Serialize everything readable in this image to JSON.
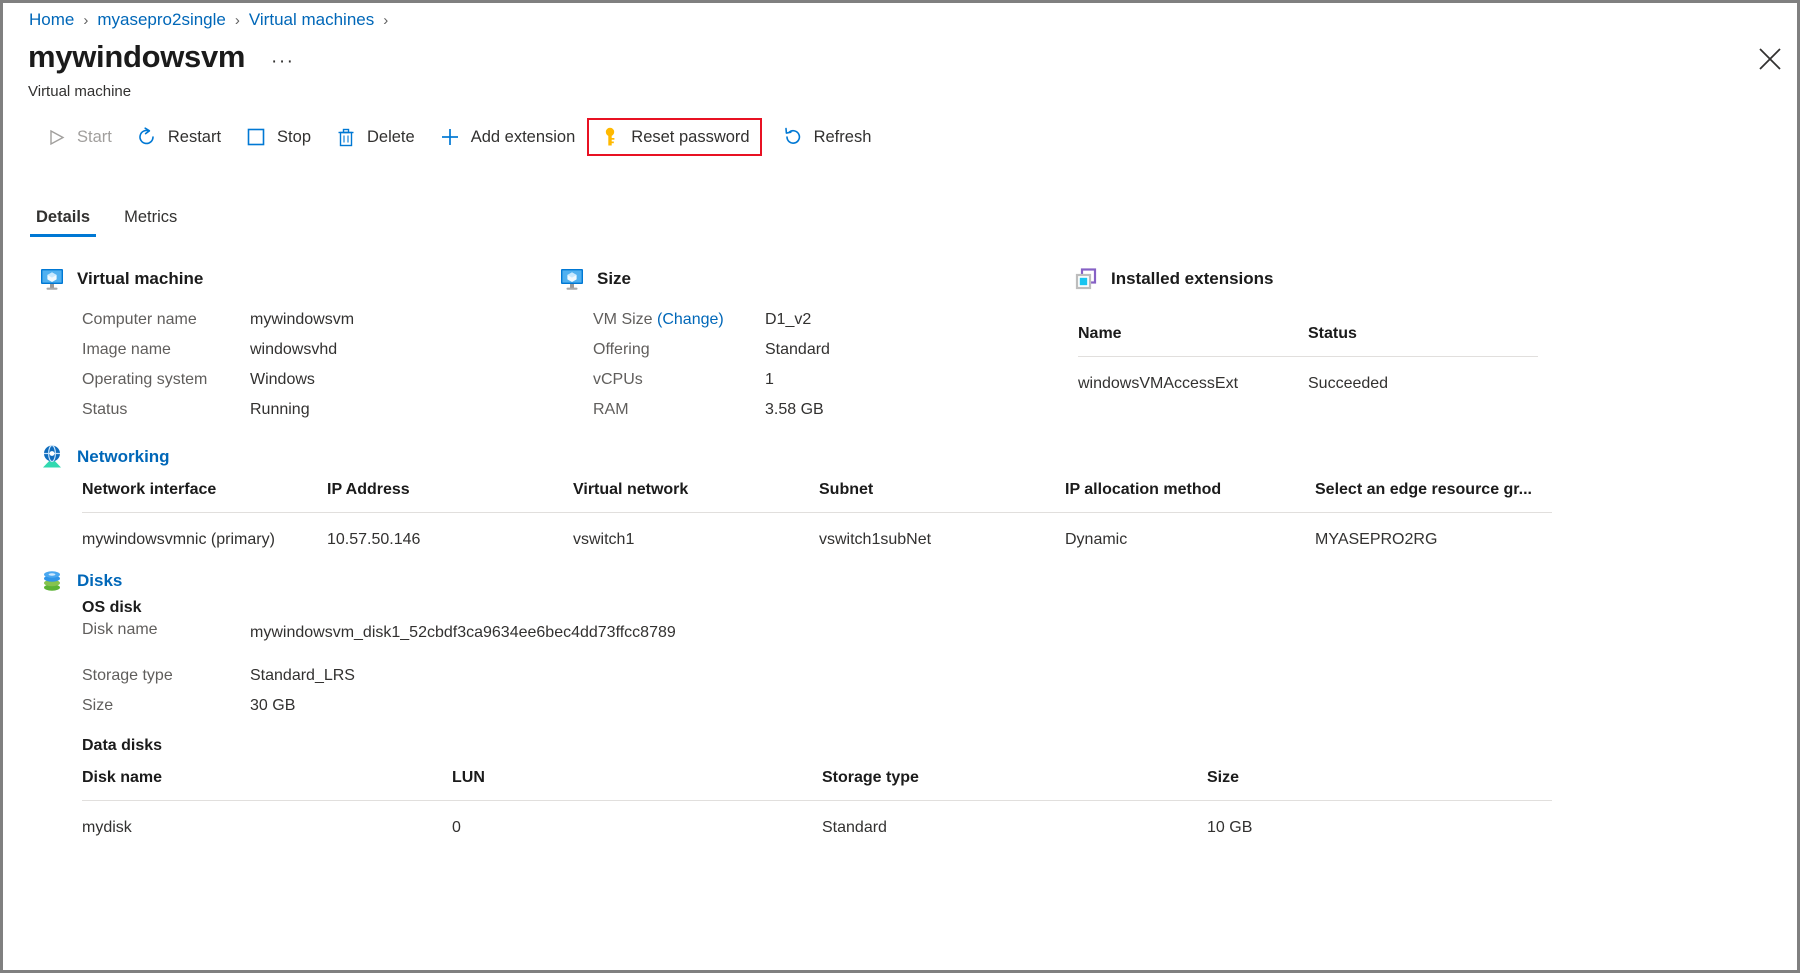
{
  "breadcrumb": {
    "items": [
      {
        "label": "Home"
      },
      {
        "label": "myasepro2single"
      },
      {
        "label": "Virtual machines"
      }
    ],
    "separator": "›"
  },
  "header": {
    "title": "mywindowsvm",
    "ellipsis": "···",
    "subtitle": "Virtual machine",
    "close_icon": "close-icon"
  },
  "toolbar": {
    "items": [
      {
        "label": "Start",
        "icon": "play-icon",
        "disabled": true,
        "highlighted": false
      },
      {
        "label": "Restart",
        "icon": "restart-icon",
        "disabled": false,
        "highlighted": false
      },
      {
        "label": "Stop",
        "icon": "stop-icon",
        "disabled": false,
        "highlighted": false
      },
      {
        "label": "Delete",
        "icon": "trash-icon",
        "disabled": false,
        "highlighted": false
      },
      {
        "label": "Add extension",
        "icon": "plus-icon",
        "disabled": false,
        "highlighted": false
      },
      {
        "label": "Reset password",
        "icon": "key-icon",
        "disabled": false,
        "highlighted": true
      },
      {
        "label": "Refresh",
        "icon": "refresh-icon",
        "disabled": false,
        "highlighted": false
      }
    ],
    "highlight_color": "#e81123"
  },
  "tabs": [
    {
      "label": "Details",
      "active": true
    },
    {
      "label": "Metrics",
      "active": false
    }
  ],
  "virtual_machine": {
    "title": "Virtual machine",
    "icon": "vm-icon",
    "rows": [
      {
        "key": "Computer name",
        "value": "mywindowsvm"
      },
      {
        "key": "Image name",
        "value": "windowsvhd"
      },
      {
        "key": "Operating system",
        "value": "Windows"
      },
      {
        "key": "Status",
        "value": "Running"
      }
    ]
  },
  "size": {
    "title": "Size",
    "icon": "vm-icon",
    "rows": [
      {
        "key": "VM Size ",
        "key_link": "(Change)",
        "value": "D1_v2"
      },
      {
        "key": "Offering",
        "value": "Standard"
      },
      {
        "key": "vCPUs",
        "value": "1"
      },
      {
        "key": "RAM",
        "value": "3.58 GB"
      }
    ]
  },
  "installed_extensions": {
    "title": "Installed extensions",
    "icon": "extensions-icon",
    "columns": [
      "Name",
      "Status"
    ],
    "rows": [
      {
        "name": "windowsVMAccessExt",
        "status": "Succeeded"
      }
    ]
  },
  "networking": {
    "title": "Networking",
    "icon": "networking-icon",
    "columns": [
      "Network interface",
      "IP Address",
      "Virtual network",
      "Subnet",
      "IP allocation method",
      "Select an edge resource gr..."
    ],
    "rows": [
      {
        "network_interface": "mywindowsvmnic (primary)",
        "ip_address": "10.57.50.146",
        "virtual_network": "vswitch1",
        "subnet": "vswitch1subNet",
        "ip_allocation_method": "Dynamic",
        "edge_resource_group": "MYASEPRO2RG"
      }
    ]
  },
  "disks": {
    "title": "Disks",
    "icon": "disks-icon",
    "os_disk": {
      "heading": "OS disk",
      "rows": [
        {
          "key": "Disk name",
          "value": "mywindowsvm_disk1_52cbdf3ca9634ee6bec4dd73ffcc8789"
        },
        {
          "key": "Storage type",
          "value": "Standard_LRS"
        },
        {
          "key": "Size",
          "value": "30 GB"
        }
      ]
    },
    "data_disks": {
      "heading": "Data disks",
      "columns": [
        "Disk name",
        "LUN",
        "Storage type",
        "Size"
      ],
      "rows": [
        {
          "disk_name": "mydisk",
          "lun": "0",
          "storage_type": "Standard",
          "size": "10 GB"
        }
      ]
    }
  },
  "colors": {
    "link": "#0067b8",
    "accent": "#0078d4",
    "text": "#323130",
    "muted": "#605e5c",
    "danger": "#e81123"
  }
}
